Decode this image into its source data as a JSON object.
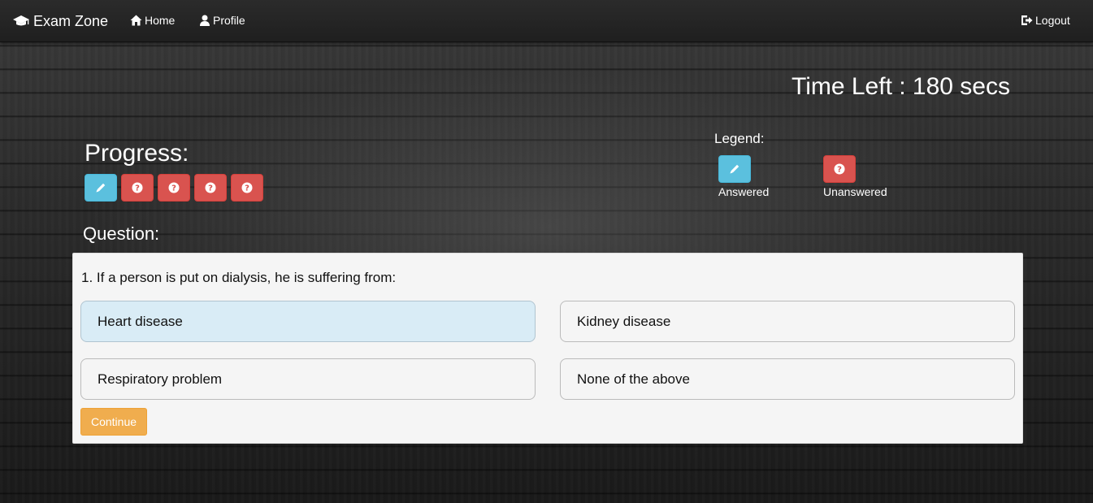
{
  "navbar": {
    "brand": "Exam Zone",
    "brand_icon": "graduation-cap-icon",
    "home_label": "Home",
    "home_icon": "home-icon",
    "profile_label": "Profile",
    "profile_icon": "user-icon",
    "logout_label": "Logout",
    "logout_icon": "logout-icon"
  },
  "timer": {
    "text": "Time Left : 180 secs"
  },
  "progress": {
    "title": "Progress:",
    "items": [
      {
        "status": "answered",
        "icon": "pencil-icon"
      },
      {
        "status": "unanswered",
        "icon": "question-circle-icon"
      },
      {
        "status": "unanswered",
        "icon": "question-circle-icon"
      },
      {
        "status": "unanswered",
        "icon": "question-circle-icon"
      },
      {
        "status": "unanswered",
        "icon": "question-circle-icon"
      }
    ]
  },
  "legend": {
    "title": "Legend:",
    "answered_label": "Answered",
    "unanswered_label": "Unanswered"
  },
  "question": {
    "title": "Question:",
    "text": "1. If a person is put on dialysis, he is suffering from:",
    "options": [
      {
        "label": "Heart disease",
        "selected": true
      },
      {
        "label": "Kidney disease",
        "selected": false
      },
      {
        "label": "Respiratory problem",
        "selected": false
      },
      {
        "label": "None of the above",
        "selected": false
      }
    ],
    "continue_label": "Continue"
  },
  "colors": {
    "answered": "#5bc0de",
    "unanswered": "#d9534f",
    "continue": "#f0ad4e",
    "selected_option": "#d9ecf6"
  }
}
